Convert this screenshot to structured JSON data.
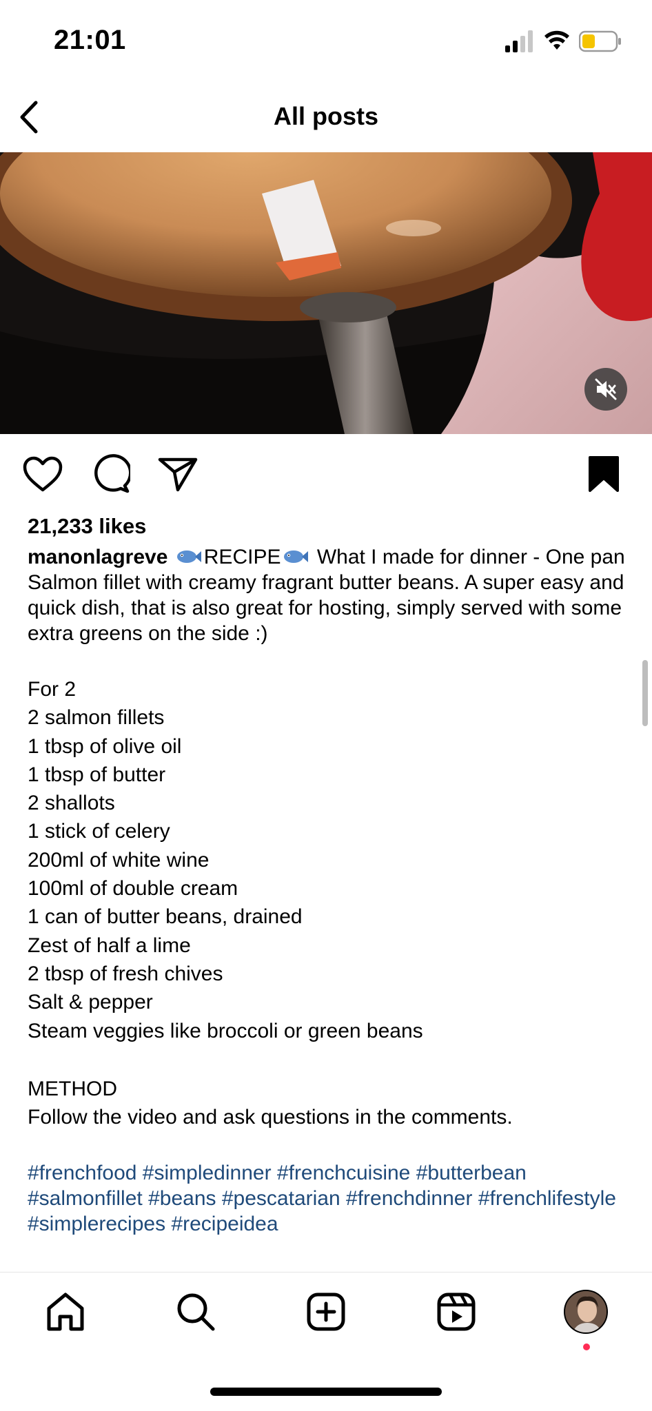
{
  "status_bar": {
    "time": "21:01",
    "icons": [
      "cellular-signal-icon",
      "wifi-icon",
      "battery-low-icon"
    ],
    "battery_color": "#f5c400"
  },
  "header": {
    "title": "All posts",
    "back_icon": "chevron-left-icon"
  },
  "media": {
    "type": "video",
    "mute_icon": "speaker-muted-icon"
  },
  "actions": {
    "icons": [
      "heart-icon",
      "comment-icon",
      "share-icon",
      "bookmark-icon"
    ]
  },
  "post": {
    "likes": "21,233 likes",
    "username": "manonlagreve",
    "recipe_label": "RECIPE",
    "caption_text": "What I made for dinner - One pan Salmon fillet with creamy fragrant butter beans. A super easy and quick dish, that is also great for hosting, simply served with some extra greens on the side :)",
    "ingredients": [
      "For 2",
      "2 salmon fillets",
      "1 tbsp of olive oil",
      "1 tbsp of butter",
      "2 shallots",
      "1 stick of celery",
      "200ml of white wine",
      "100ml of double cream",
      "1 can of butter beans, drained",
      "Zest of half a lime",
      "2 tbsp of fresh chives",
      "Salt & pepper",
      "Steam veggies like broccoli or green beans"
    ],
    "method_heading": "METHOD",
    "method_text": "Follow the video and ask questions in the comments.",
    "hashtags": [
      "#frenchfood",
      "#simpledinner",
      "#frenchcuisine",
      "#butterbean",
      "#salmonfillet",
      "#beans",
      "#pescatarian",
      "#frenchdinner",
      "#frenchlifestyle",
      "#simplerecipes",
      "#recipeidea"
    ],
    "hashtag_color": "#1f4a7a"
  },
  "tab_bar": {
    "tabs": [
      "home-icon",
      "search-icon",
      "create-post-icon",
      "reels-icon",
      "profile-avatar"
    ],
    "notification_dot_color": "#ff2d55"
  }
}
